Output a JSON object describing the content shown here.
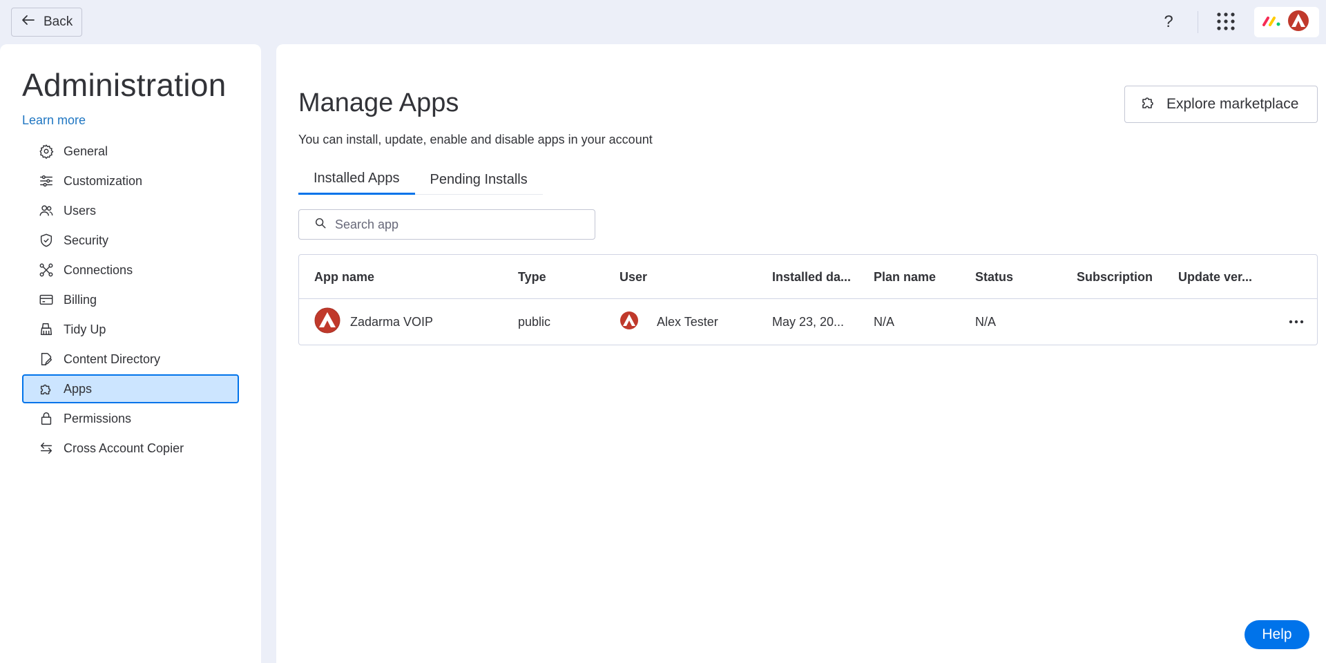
{
  "topbar": {
    "back_label": "Back",
    "help_symbol": "?",
    "icons": [
      "arrow-left-icon",
      "question-icon",
      "apps-grid-icon",
      "monday-logo",
      "user-avatar"
    ]
  },
  "sidebar": {
    "title": "Administration",
    "learn_more": "Learn more",
    "items": [
      {
        "label": "General",
        "icon": "gear-icon"
      },
      {
        "label": "Customization",
        "icon": "sliders-icon"
      },
      {
        "label": "Users",
        "icon": "users-icon"
      },
      {
        "label": "Security",
        "icon": "shield-icon"
      },
      {
        "label": "Connections",
        "icon": "connections-icon"
      },
      {
        "label": "Billing",
        "icon": "credit-card-icon"
      },
      {
        "label": "Tidy Up",
        "icon": "broom-icon"
      },
      {
        "label": "Content Directory",
        "icon": "document-edit-icon"
      },
      {
        "label": "Apps",
        "icon": "puzzle-icon",
        "active": true
      },
      {
        "label": "Permissions",
        "icon": "lock-icon"
      },
      {
        "label": "Cross Account Copier",
        "icon": "swap-arrows-icon"
      }
    ]
  },
  "main": {
    "title": "Manage Apps",
    "subtitle": "You can install, update, enable and disable apps in your account",
    "explore_label": "Explore marketplace",
    "tabs": [
      {
        "label": "Installed Apps",
        "active": true
      },
      {
        "label": "Pending Installs",
        "active": false
      }
    ],
    "search": {
      "placeholder": "Search app",
      "value": ""
    },
    "table": {
      "columns": [
        "App name",
        "Type",
        "User",
        "Installed da...",
        "Plan name",
        "Status",
        "Subscription",
        "Update ver..."
      ],
      "rows": [
        {
          "app_name": "Zadarma VOIP",
          "type": "public",
          "user": "Alex Tester",
          "installed_date": "May 23, 20...",
          "plan_name": "N/A",
          "status": "N/A",
          "subscription": "",
          "update_version": ""
        }
      ]
    }
  },
  "help_button": "Help",
  "colors": {
    "accent": "#0073ea",
    "active_bg": "#cce5ff",
    "link": "#1f76c2",
    "app_icon": "#c0392b"
  }
}
